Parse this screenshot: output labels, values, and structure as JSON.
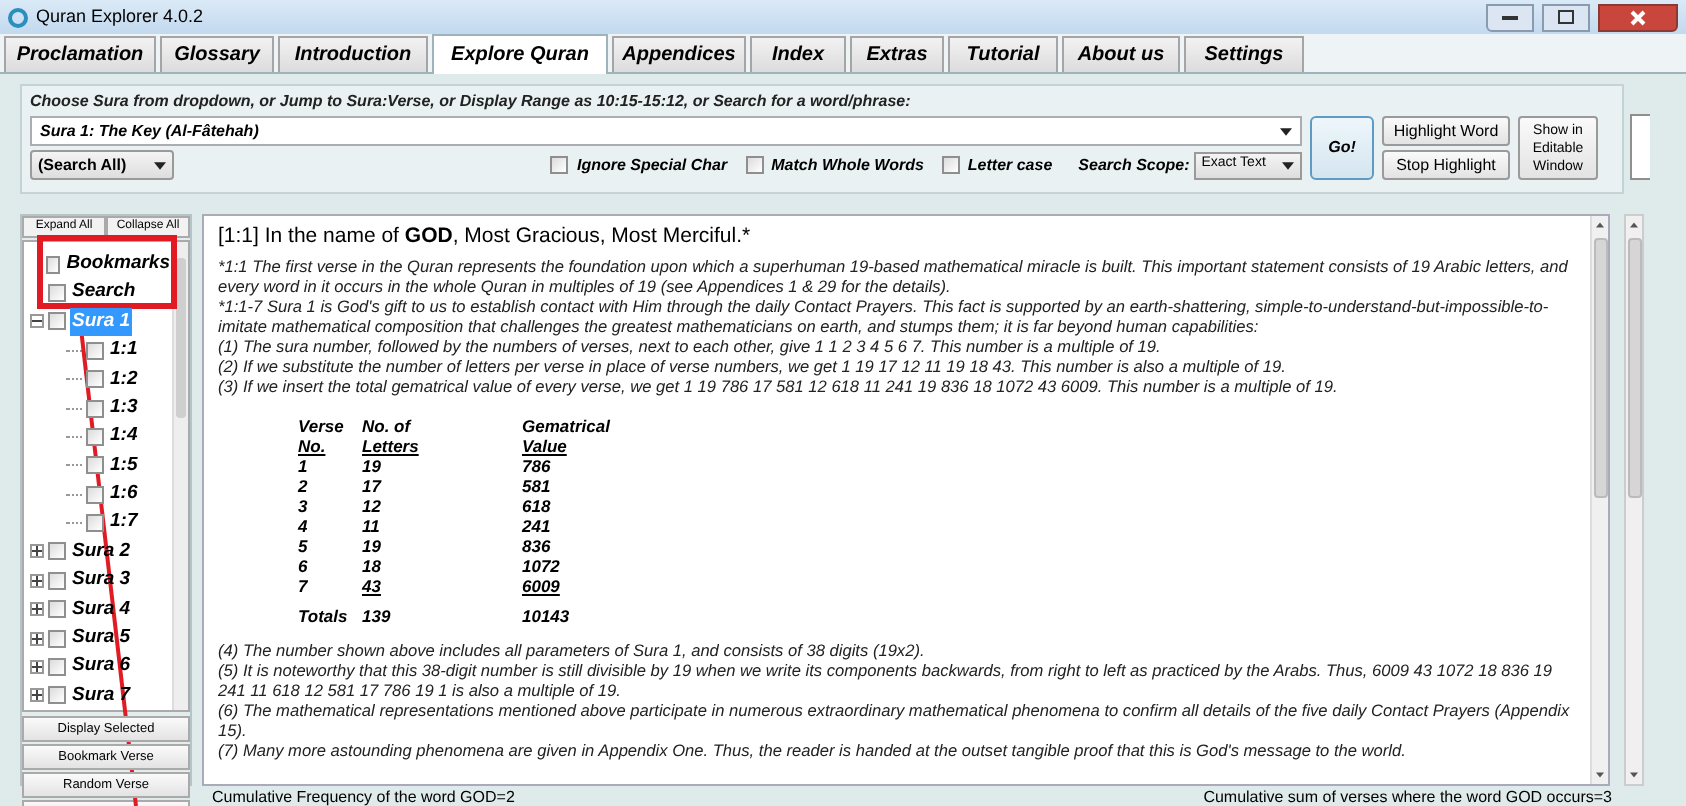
{
  "window": {
    "title": "Quran Explorer 4.0.2"
  },
  "tabs": [
    {
      "label": "Proclamation",
      "selected": false
    },
    {
      "label": "Glossary",
      "selected": false
    },
    {
      "label": "Introduction",
      "selected": false
    },
    {
      "label": "Explore Quran",
      "selected": true
    },
    {
      "label": "Appendices",
      "selected": false
    },
    {
      "label": "Index",
      "selected": false
    },
    {
      "label": "Extras",
      "selected": false
    },
    {
      "label": "Tutorial",
      "selected": false
    },
    {
      "label": "About us",
      "selected": false
    },
    {
      "label": "Settings",
      "selected": false
    }
  ],
  "search_panel": {
    "instruction": "Choose Sura from dropdown, or Jump to Sura:Verse, or Display Range as 10:15-15:12, or Search for a word/phrase:",
    "sura_dropdown": {
      "value": "Sura 1:  The Key (Al-Fâtehah)"
    },
    "search_in_dropdown": {
      "value": "(Search All)"
    },
    "options": [
      {
        "label": "Ignore Special Char",
        "checked": false
      },
      {
        "label": "Match Whole Words",
        "checked": false
      },
      {
        "label": "Letter case",
        "checked": false
      }
    ],
    "scope_label": "Search Scope:",
    "scope_dropdown": {
      "value": "Exact Text"
    },
    "go_button": "Go!",
    "highlight_buttons": [
      "Highlight Word",
      "Stop Highlight"
    ],
    "editable_button": "Show in Editable Window"
  },
  "tree": {
    "buttons": [
      "Expand All",
      "Collapse All"
    ],
    "items": [
      {
        "kind": "root",
        "label": "Bookmarks",
        "checked": false,
        "selected": false
      },
      {
        "kind": "root",
        "label": "Search",
        "checked": false,
        "selected": false
      },
      {
        "kind": "sura",
        "label": "Sura 1",
        "checked": false,
        "selected": true,
        "expanded": true,
        "children": [
          {
            "label": "1:1",
            "checked": false,
            "selected": false
          },
          {
            "label": "1:2",
            "checked": false,
            "selected": false
          },
          {
            "label": "1:3",
            "checked": false,
            "selected": false
          },
          {
            "label": "1:4",
            "checked": false,
            "selected": false
          },
          {
            "label": "1:5",
            "checked": false,
            "selected": false
          },
          {
            "label": "1:6",
            "checked": false,
            "selected": false
          },
          {
            "label": "1:7",
            "checked": false,
            "selected": false
          }
        ]
      },
      {
        "kind": "sura",
        "label": "Sura 2",
        "checked": false,
        "selected": false,
        "expanded": false
      },
      {
        "kind": "sura",
        "label": "Sura 3",
        "checked": false,
        "selected": false,
        "expanded": false
      },
      {
        "kind": "sura",
        "label": "Sura 4",
        "checked": false,
        "selected": false,
        "expanded": false
      },
      {
        "kind": "sura",
        "label": "Sura 5",
        "checked": false,
        "selected": false,
        "expanded": false
      },
      {
        "kind": "sura",
        "label": "Sura 6",
        "checked": false,
        "selected": false,
        "expanded": false
      },
      {
        "kind": "sura",
        "label": "Sura 7",
        "checked": false,
        "selected": false,
        "expanded": false
      }
    ],
    "action_buttons": [
      "Display Selected",
      "Bookmark Verse",
      "Random Verse"
    ]
  },
  "content": {
    "heading": "[1:1] In the name of **GOD**, Most Gracious, Most Merciful.*",
    "notes": [
      "*1:1 The first verse in the Quran represents the foundation upon which a superhuman 19-based mathematical miracle is built. This important statement consists of 19 Arabic letters, and every word in it occurs in the whole Quran in multiples of 19 (see Appendices 1 & 29 for the details).",
      "*1:1-7 Sura 1 is God's gift to us to establish contact with Him through the daily Contact Prayers. This fact is supported by an earth-shattering, simple-to-understand-but-impossible-to-imitate mathematical composition that challenges the greatest mathematicians on earth, and stumps them; it is far beyond human capabilities:",
      "(1) The sura number, followed by the numbers of verses, next to each other, give 1 1 2 3 4 5 6 7. This number is a multiple of 19.",
      "(2) If we substitute the number of letters per verse in place of verse numbers, we get 1 19 17 12 11 19 18 43. This number is also a multiple of 19.",
      "(3) If we insert the total gematrical value of every verse, we get 1 19 786 17 581 12 618 11 241 19 836 18 1072 43 6009. This number is a multiple of 19."
    ],
    "table": {
      "columns": [
        {
          "line_1": "Verse",
          "line_2": "No."
        },
        {
          "line_1": "No. of",
          "line_2": "Letters"
        },
        {
          "line_1": "Gematrical",
          "line_2": "Value"
        }
      ],
      "rows": [
        {
          "cells": [
            "1",
            "19",
            "786"
          ],
          "underlined": false
        },
        {
          "cells": [
            "2",
            "17",
            "581"
          ],
          "underlined": false
        },
        {
          "cells": [
            "3",
            "12",
            "618"
          ],
          "underlined": false
        },
        {
          "cells": [
            "4",
            "11",
            "241"
          ],
          "underlined": false
        },
        {
          "cells": [
            "5",
            "19",
            "836"
          ],
          "underlined": false
        },
        {
          "cells": [
            "6",
            "18",
            "1072"
          ],
          "underlined": false
        },
        {
          "cells": [
            "7",
            "43",
            "6009"
          ],
          "underlined": true
        }
      ],
      "totals": [
        "Totals",
        "139",
        "10143"
      ]
    },
    "notes_after": [
      "(4) The number shown above includes all parameters of Sura 1, and consists of 38 digits (19x2).",
      "(5) It is noteworthy that this 38-digit number is still divisible by 19 when we write its components backwards, from right to left as practiced by the Arabs. Thus, 6009 43 1072 18 836 19 241 11 618 12 581 17 786 19 1 is also a multiple of 19.",
      "(6) The mathematical representations mentioned above participate in numerous extraordinary mathematical phenomena to confirm all details of the five daily Contact Prayers (Appendix 15).",
      "(7) Many more astounding phenomena are given in Appendix One. Thus, the reader is handed at the outset tangible proof that this is God's message to the world."
    ]
  },
  "status_bar": {
    "left": "Cumulative Frequency of the word GOD=2",
    "right": "Cumulative sum of verses where the word GOD occurs=3"
  }
}
